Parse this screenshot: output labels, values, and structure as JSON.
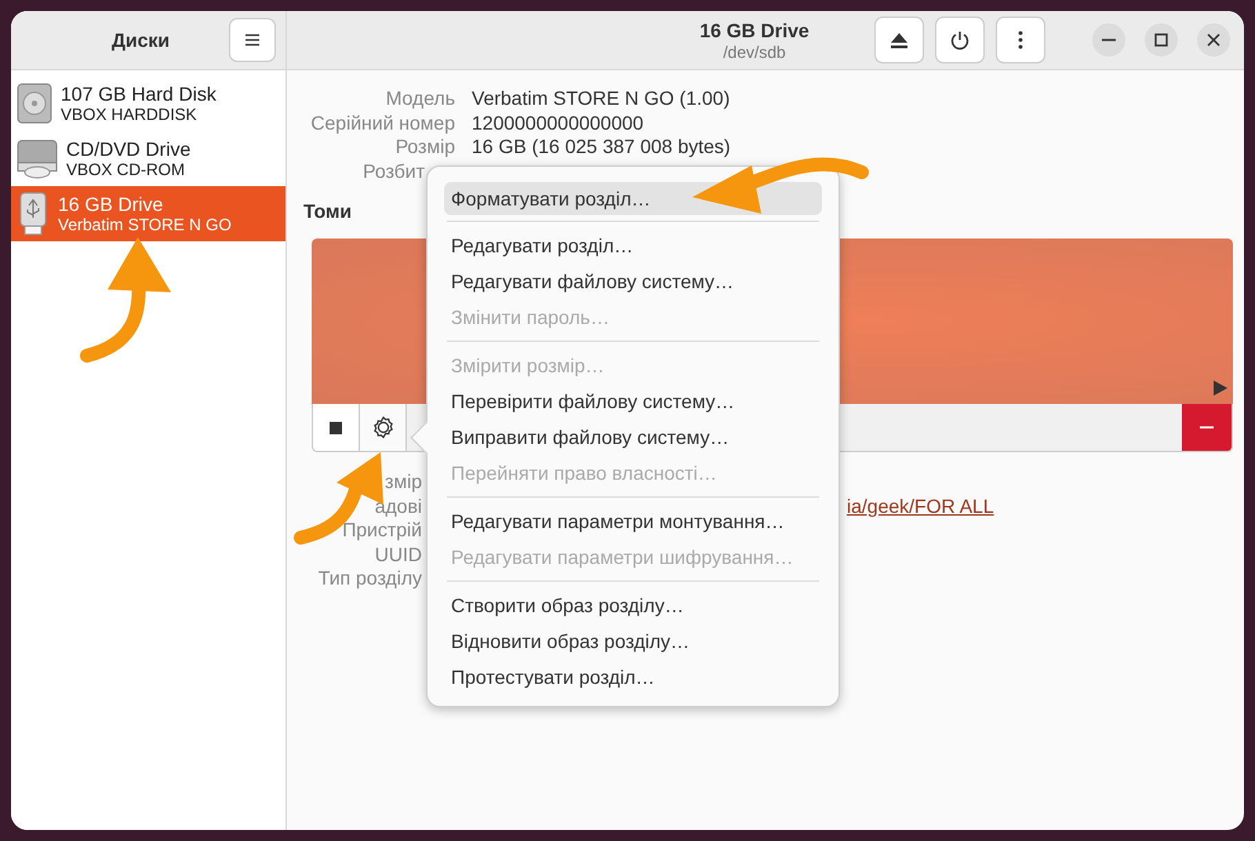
{
  "sidebar": {
    "title": "Диски",
    "items": [
      {
        "kind": "harddisk",
        "name": "107 GB Hard Disk",
        "subtitle": "VBOX HARDDISK",
        "selected": false
      },
      {
        "kind": "optical",
        "name": "CD/DVD Drive",
        "subtitle": "VBOX CD-ROM",
        "selected": false
      },
      {
        "kind": "usb",
        "name": "16 GB Drive",
        "subtitle": "Verbatim STORE N GO",
        "selected": true
      }
    ]
  },
  "header": {
    "title": "16 GB Drive",
    "subtitle": "/dev/sdb"
  },
  "drive_info": [
    {
      "label": "Модель",
      "value": "Verbatim STORE N GO (1.00)"
    },
    {
      "label": "Серійний номер",
      "value": "1200000000000000"
    },
    {
      "label": "Розмір",
      "value": "16 GB (16 025 387 008 bytes)"
    },
    {
      "label": "Розбит"
    }
  ],
  "volumes": {
    "title": "Томи"
  },
  "volume_info": [
    {
      "label": "змір"
    },
    {
      "label": "адові",
      "value": "ia/geek/FOR ALL"
    },
    {
      "label": "Пристрій"
    },
    {
      "label": "UUID"
    },
    {
      "label": "Тип розділу"
    }
  ],
  "menu": [
    [
      {
        "label": "Форматувати розділ…",
        "disabled": false,
        "selected": true
      }
    ],
    [
      {
        "label": "Редагувати розділ…",
        "disabled": false,
        "selected": false
      },
      {
        "label": "Редагувати файлову систему…",
        "disabled": false,
        "selected": false
      },
      {
        "label": "Змінити пароль…",
        "disabled": true,
        "selected": false
      }
    ],
    [
      {
        "label": "Змірити розмір…",
        "disabled": true,
        "selected": false
      },
      {
        "label": "Перевірити файлову систему…",
        "disabled": false,
        "selected": false
      },
      {
        "label": "Виправити файлову систему…",
        "disabled": false,
        "selected": false
      },
      {
        "label": "Перейняти право власності…",
        "disabled": true,
        "selected": false
      }
    ],
    [
      {
        "label": "Редагувати параметри монтування…",
        "disabled": false,
        "selected": false
      },
      {
        "label": "Редагувати параметри шифрування…",
        "disabled": true,
        "selected": false
      }
    ],
    [
      {
        "label": "Створити образ розділу…",
        "disabled": false,
        "selected": false
      },
      {
        "label": "Відновити образ розділу…",
        "disabled": false,
        "selected": false
      },
      {
        "label": "Протестувати розділ…",
        "disabled": false,
        "selected": false
      }
    ]
  ]
}
